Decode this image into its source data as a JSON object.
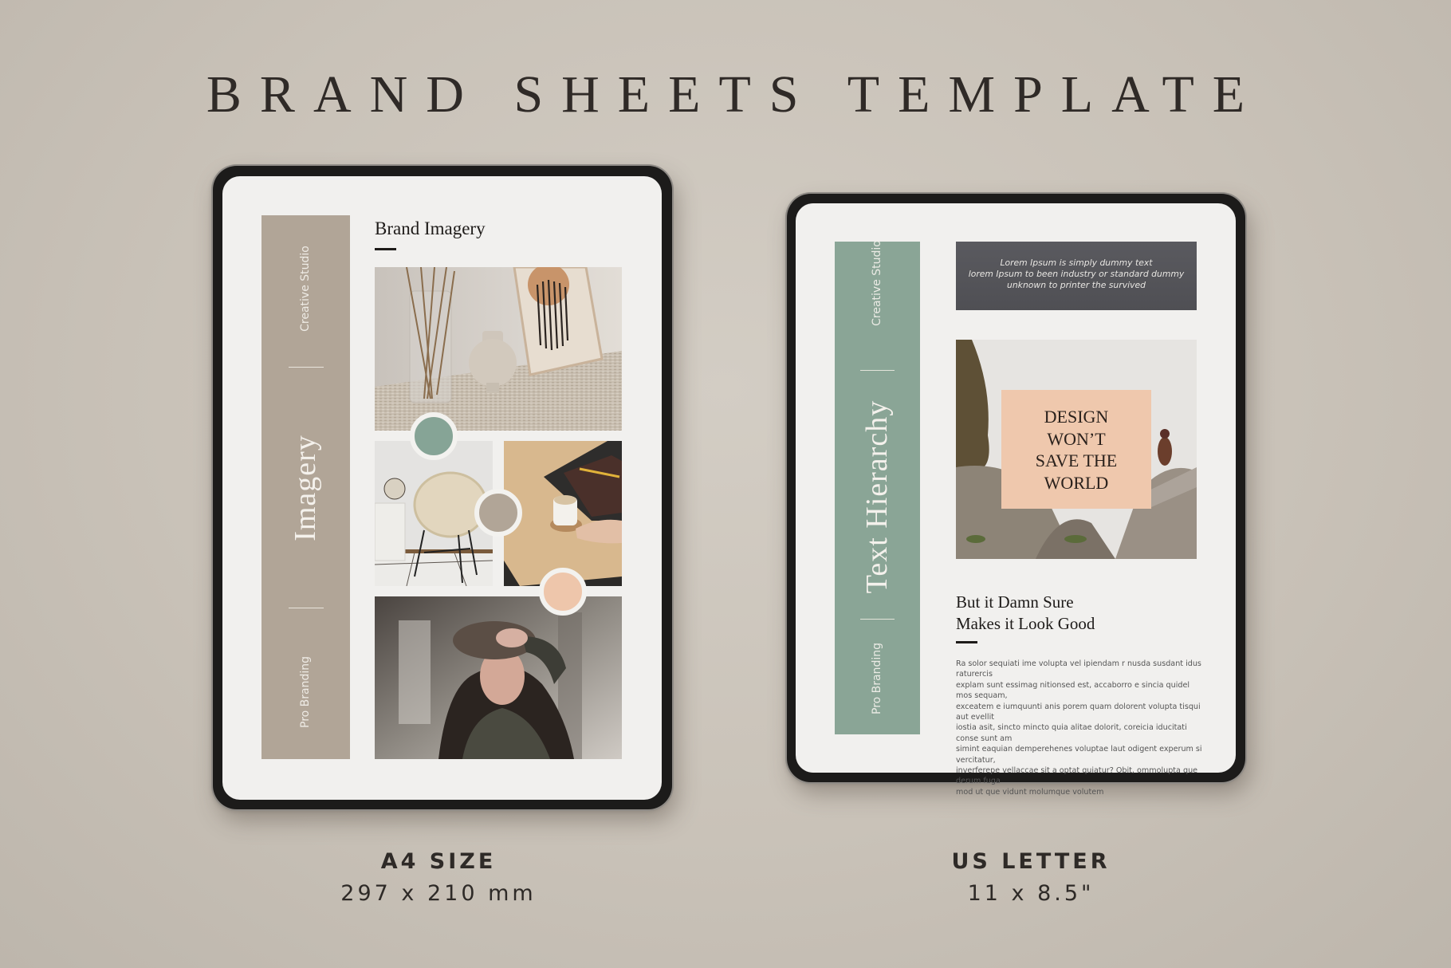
{
  "header": {
    "title": "BRAND SHEETS TEMPLATE"
  },
  "colors": {
    "background": "#cbc4ba",
    "taupe": "#b1a597",
    "sage": "#8aa596",
    "charcoal": "#545459",
    "peach": "#efc8ad",
    "swatch_green": "#86a496",
    "swatch_taupe": "#b1a597",
    "swatch_peach": "#eec6ab"
  },
  "a4_sheet": {
    "sidebar": {
      "top_label": "Creative Studio",
      "main_label": "Imagery",
      "bottom_label": "Pro Branding"
    },
    "heading": "Brand Imagery",
    "images": [
      {
        "name": "vase-and-art-print",
        "description": "vase with dried stems, ceramic pot and framed line art on woven rug"
      },
      {
        "name": "rattan-chair",
        "description": "rattan chair beside white cabinet with globe"
      },
      {
        "name": "desk-coffee",
        "description": "hand reaching coffee cup on wooden desk with notebook"
      },
      {
        "name": "woman-portrait",
        "description": "woman in beret with hand on forehead"
      }
    ],
    "swatches": [
      {
        "name": "sage",
        "color": "#86a496"
      },
      {
        "name": "taupe",
        "color": "#b1a597"
      },
      {
        "name": "peach",
        "color": "#eec6ab"
      }
    ],
    "caption": {
      "title": "A4 SIZE",
      "dimensions": "297 x 210 mm"
    }
  },
  "letter_sheet": {
    "sidebar": {
      "top_label": "Creative Studio",
      "main_label": "Text Hierarchy",
      "bottom_label": "Pro Branding"
    },
    "quote_box": {
      "lines": [
        "Lorem Ipsum is simply dummy text",
        "lorem Ipsum to been industry or standard dummy",
        "unknown to printer the survived"
      ]
    },
    "feature_image": {
      "description": "person sitting on rocky cliff in fog beside pine tree",
      "overlay_lines": [
        "DESIGN",
        "WON’T",
        "SAVE THE",
        "WORLD"
      ]
    },
    "heading_lines": [
      "But it Damn Sure",
      "Makes it Look Good"
    ],
    "body_lines": [
      "Ra solor sequiati ime volupta vel ipiendam r nusda susdant idus raturercis",
      "explam sunt essimag nitionsed est, accaborro e sincia quidel mos sequam,",
      "exceatem e iumquunti anis porem quam dolorent volupta tisqui aut evellit",
      "iostia asit, sincto mincto quia alitae dolorit, coreicia iducitati conse sunt am",
      "simint eaquian demperehenes voluptae laut odigent experum si vercitatur,",
      "inverferepe vellaccae sit a optat quiatur? Obit, ommolupta que derum fuga",
      "mod ut que vidunt molumque volutem"
    ],
    "caption": {
      "title": "US LETTER",
      "dimensions": "11 x 8.5\""
    }
  }
}
